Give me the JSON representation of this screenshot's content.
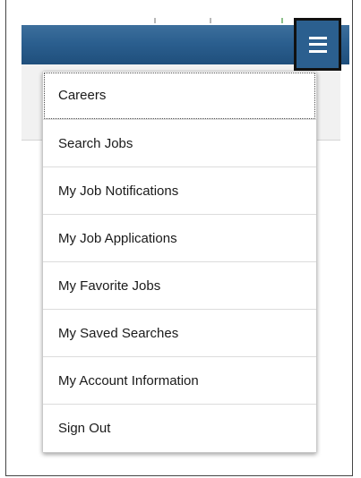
{
  "menu": {
    "items": [
      {
        "label": "Careers",
        "focused": true
      },
      {
        "label": "Search Jobs"
      },
      {
        "label": "My Job Notifications"
      },
      {
        "label": "My Job Applications"
      },
      {
        "label": "My Favorite Jobs"
      },
      {
        "label": "My Saved Searches"
      },
      {
        "label": "My Account Information"
      },
      {
        "label": "Sign Out"
      }
    ]
  },
  "header": {
    "menu_icon": "hamburger-menu-icon"
  },
  "colors": {
    "header_bar": "#2b5f8f",
    "menu_background": "#ffffff",
    "menu_text": "#1a1a1a"
  }
}
